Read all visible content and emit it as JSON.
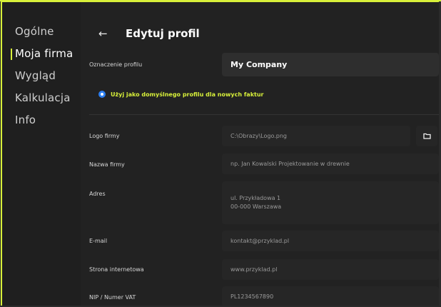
{
  "sidebar": {
    "items": [
      {
        "label": "Ogólne"
      },
      {
        "label": "Moja firma"
      },
      {
        "label": "Wygląd"
      },
      {
        "label": "Kalkulacja"
      },
      {
        "label": "Info"
      }
    ],
    "active_index": 1
  },
  "header": {
    "back_icon": "arrow-left-icon",
    "title": "Edytuj profil"
  },
  "profile": {
    "label": "Oznaczenie profilu",
    "value": "My Company"
  },
  "default_option": {
    "label": "Użyj jako domyślnego profilu dla nowych faktur",
    "checked": true
  },
  "form": {
    "logo": {
      "label": "Logo firmy",
      "value": "C:\\Obrazy\\Logo.png",
      "button_icon": "folder-icon"
    },
    "name": {
      "label": "Nazwa firmy",
      "placeholder": "np. Jan Kowalski Projektowanie w drewnie"
    },
    "address": {
      "label": "Adres",
      "line1": "ul. Przykładowa 1",
      "line2": "00-000 Warszawa"
    },
    "email": {
      "label": "E-mail",
      "value": "kontakt@przyklad.pl"
    },
    "website": {
      "label": "Strona internetowa",
      "value": "www.przyklad.pl"
    },
    "vat": {
      "label": "NIP / Numer VAT",
      "value": "PL1234567890"
    }
  },
  "colors": {
    "accent": "#d8f03a",
    "radio": "#2d7ff0",
    "background": "#222222"
  }
}
